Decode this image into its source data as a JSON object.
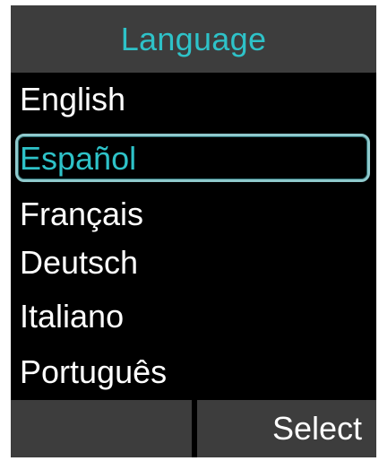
{
  "header": {
    "title": "Language"
  },
  "languages": {
    "items": [
      {
        "label": "English"
      },
      {
        "label": "Español"
      },
      {
        "label": "Français"
      },
      {
        "label": "Deutsch"
      },
      {
        "label": "Italiano"
      },
      {
        "label": "Português"
      }
    ],
    "selected_index": 1
  },
  "softkeys": {
    "left_label": "",
    "right_label": "Select"
  },
  "colors": {
    "accent": "#2ec2c8",
    "bar_background": "#3d3d3d",
    "screen_background": "#000000",
    "text": "#ffffff",
    "selection_border": "#8fc9cc"
  }
}
